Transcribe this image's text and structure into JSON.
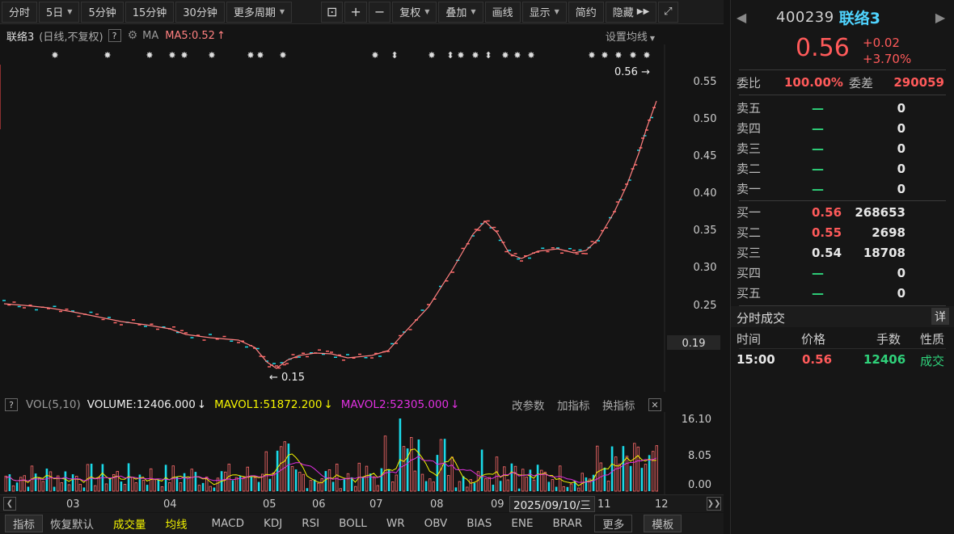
{
  "toolbar": {
    "periods": [
      "分时",
      "5日",
      "5分钟",
      "15分钟",
      "30分钟",
      "更多周期"
    ],
    "tools": [
      "复权",
      "叠加",
      "画线",
      "显示",
      "简约",
      "隐藏"
    ]
  },
  "chart_head": {
    "name": "联络3",
    "sub": "(日线,不复权)",
    "help": "?",
    "ma": "MA",
    "ma5": "MA5:0.52",
    "set_avg": "设置均线"
  },
  "markers": {
    "high": "0.56",
    "low": "0.15"
  },
  "y_axis": {
    "ticks": [
      "0.55",
      "0.50",
      "0.45",
      "0.40",
      "0.35",
      "0.30",
      "0.25"
    ],
    "current_box": "0.19"
  },
  "vol_head": {
    "help": "?",
    "label": "VOL(5,10)",
    "volume": "VOLUME:12406.000",
    "mavol1": "MAVOL1:51872.200",
    "mavol2": "MAVOL2:52305.000",
    "change_params": "改参数",
    "add_indicator": "加指标",
    "switch_indicator": "换指标",
    "close": "✕"
  },
  "vol_axis": {
    "ticks": [
      "16.10",
      "8.05",
      "0.00"
    ]
  },
  "x_axis": {
    "labels": [
      "03",
      "04",
      "05",
      "06",
      "07",
      "08",
      "09",
      "11",
      "12"
    ],
    "cursor_date": "2025/09/10/三"
  },
  "bottom_tabs": [
    "指标",
    "恢复默认",
    "成交量",
    "均线",
    "MACD",
    "KDJ",
    "RSI",
    "BOLL",
    "WR",
    "OBV",
    "BIAS",
    "ENE",
    "BRAR",
    "更多",
    "模板"
  ],
  "quote": {
    "code": "400239",
    "name": "联络3",
    "price": "0.56",
    "change": "+0.02",
    "change_pct": "+3.70%",
    "weibi_label": "委比",
    "weibi": "100.00%",
    "weicha_label": "委差",
    "weicha": "290059",
    "asks": [
      {
        "label": "卖五",
        "price": "—",
        "vol": "0"
      },
      {
        "label": "卖四",
        "price": "—",
        "vol": "0"
      },
      {
        "label": "卖三",
        "price": "—",
        "vol": "0"
      },
      {
        "label": "卖二",
        "price": "—",
        "vol": "0"
      },
      {
        "label": "卖一",
        "price": "—",
        "vol": "0"
      }
    ],
    "bids": [
      {
        "label": "买一",
        "price": "0.56",
        "vol": "268653"
      },
      {
        "label": "买二",
        "price": "0.55",
        "vol": "2698"
      },
      {
        "label": "买三",
        "price": "0.54",
        "vol": "18708"
      },
      {
        "label": "买四",
        "price": "—",
        "vol": "0"
      },
      {
        "label": "买五",
        "price": "—",
        "vol": "0"
      }
    ],
    "ticks_title": "分时成交",
    "detail": "详",
    "ticks_headers": [
      "时间",
      "价格",
      "手数",
      "性质"
    ],
    "ticks": [
      {
        "time": "15:00",
        "price": "0.56",
        "vol": "12406",
        "type": "成交"
      }
    ]
  },
  "colors": {
    "up": "#ff5a5a",
    "down": "#2fd17a",
    "ma": "#ff7f7f",
    "cyan": "#1ad9e8",
    "mavol1": "#f4f400",
    "mavol2": "#e030e0",
    "name": "#4fd4ff"
  }
}
